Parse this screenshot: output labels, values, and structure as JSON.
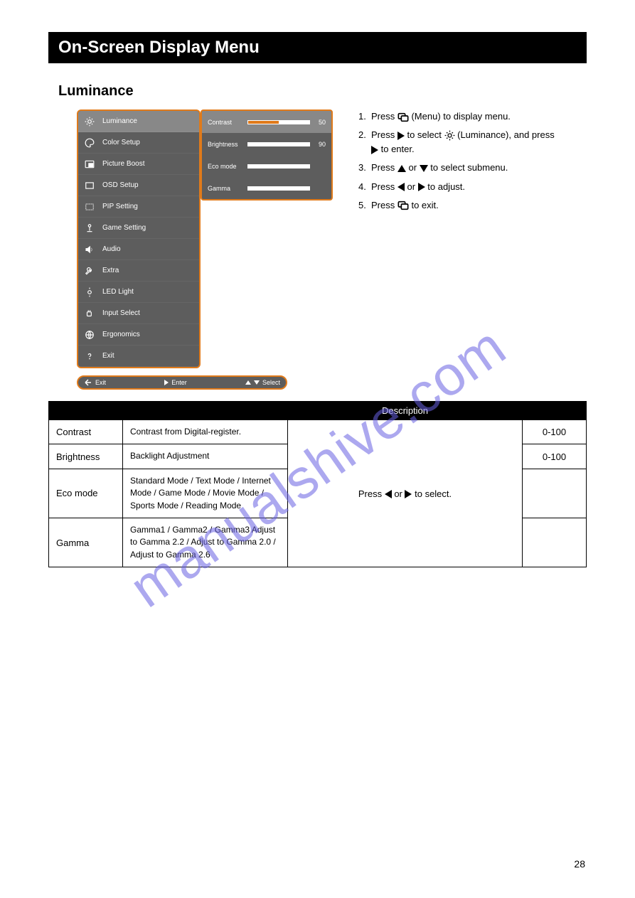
{
  "watermark": "manualshive.com",
  "title": "On-Screen Display Menu",
  "subtitle": "Luminance",
  "steps": {
    "s1_a": "Press ",
    "s1_b": " (Menu) to display menu.",
    "s2_a": "Press ",
    "s2_b": " to select ",
    "s2_c": " (Luminance), and press",
    "s2_d": " to enter.",
    "s3_a": "Press ",
    "s3_b": " or ",
    "s3_c": " to select submenu.",
    "s4_a": "Press ",
    "s4_b": " or ",
    "s4_c": " to adjust.",
    "s5_a": "Press ",
    "s5_b": " to exit."
  },
  "osd": {
    "menu_title": "Luminance",
    "items": [
      "Luminance",
      "Color Setup",
      "Picture Boost",
      "OSD Setup",
      "PIP Setting",
      "Game Setting",
      "Audio",
      "Extra",
      "LED Light",
      "Input Select",
      "Ergonomics",
      "Exit"
    ],
    "sub": [
      {
        "label": "Contrast",
        "val": "50",
        "fill": 50
      },
      {
        "label": "Brightness",
        "val": "90",
        "fill": 90
      },
      {
        "label": "Eco mode",
        "val": "",
        "fill": 100
      },
      {
        "label": "Gamma",
        "val": "",
        "fill": 100
      }
    ],
    "footer": {
      "exit": "Exit",
      "enter": "Enter",
      "select": "Select"
    }
  },
  "table": {
    "headers": [
      "",
      "",
      "Description",
      ""
    ],
    "rows": [
      {
        "c1": "Contrast",
        "c2": "Contrast from Digital-register.",
        "c4": "0-100"
      },
      {
        "c1": "Brightness",
        "c2": "Backlight Adjustment",
        "c4": "0-100"
      },
      {
        "c1": "Eco mode",
        "c2": "Standard Mode / Text Mode / Internet Mode / Game Mode / Movie Mode / Sports Mode / Reading Mode",
        "c4": ""
      },
      {
        "c1": "Gamma",
        "c2": "Gamma1 / Gamma2 / Gamma3 Adjust to Gamma 2.2 / Adjust to Gamma 2.0 / Adjust to Gamma 2.6",
        "c4": ""
      }
    ],
    "c3_a": "Press ",
    "c3_b": " or ",
    "c3_c": " to select."
  },
  "page": "28"
}
